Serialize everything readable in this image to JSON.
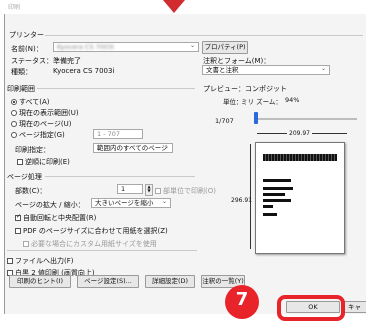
{
  "window": {
    "title": "印刷"
  },
  "printer": {
    "section": "プリンター",
    "name_label": "名前(N)：",
    "name_value": "Kyocera CS 7003i",
    "properties_btn": "プロパティ(P)",
    "status_label": "ステータス：",
    "status_value": "準備完了",
    "type_label": "種類：",
    "type_value": "Kyocera CS 7003i",
    "comments_label": "注釈とフォーム(M)：",
    "comments_value": "文書と注釈"
  },
  "range": {
    "section": "印刷範囲",
    "all": "すべて(A)",
    "current_view": "現在の表示範囲(U)",
    "current_page": "現在のページ(U)",
    "pages": "ページ指定(G)",
    "pages_value": "1 - 707",
    "subset_label": "印刷指定：",
    "subset_value": "範囲内のすべてのページ",
    "reverse": "逆順に印刷(E)"
  },
  "handling": {
    "section": "ページ処理",
    "copies_label": "部数(C)：",
    "copies_value": "1",
    "collate": "部単位で印刷(O)",
    "scale_label": "ページの拡大 / 縮小：",
    "scale_value": "大きいページを縮小",
    "auto_rotate": "自動回転と中央配置(R)",
    "pdf_size": "PDF のページサイズに合わせて用紙を選択(Z)",
    "custom_paper": "必要な場合にカスタム用紙サイズを使用"
  },
  "bottom_opts": {
    "print_to_file": "ファイルへ出力(F)",
    "bw": "白黒 2 値印刷 (画質向上)"
  },
  "preview": {
    "title": "プレビュー：コンポジット",
    "units_label": "単位：",
    "units_value": "ミリ ズーム：",
    "zoom_value": "94%",
    "page_counter": "1/707",
    "width_value": "209.97",
    "height_value": "296.91"
  },
  "footer": {
    "tips_btn": "印刷のヒント(I)",
    "page_setup_btn": "ページ設定(S)...",
    "advanced_btn": "詳細設定(D)",
    "summarize_btn": "注釈の一覧(Y)",
    "ok_btn": "OK",
    "cancel_btn": "キャンセル"
  },
  "annotation": {
    "step_number": "7"
  },
  "colors": {
    "highlight": "#e8242a",
    "slider_blue": "#2a6ae0",
    "marker": "#d12a2f"
  }
}
